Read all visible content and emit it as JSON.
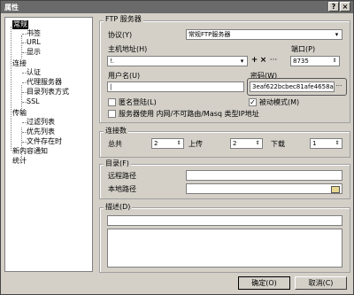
{
  "window": {
    "title": "属性",
    "help": "?",
    "close": "×"
  },
  "tree": {
    "items": [
      {
        "label": "常规"
      },
      {
        "label": "书签"
      },
      {
        "label": "URL"
      },
      {
        "label": "显示"
      },
      {
        "label": "连接"
      },
      {
        "label": "认证"
      },
      {
        "label": "代理服务器"
      },
      {
        "label": "目录列表方式"
      },
      {
        "label": "SSL"
      },
      {
        "label": "传输"
      },
      {
        "label": "过滤列表"
      },
      {
        "label": "优先列表"
      },
      {
        "label": "文件存在时"
      },
      {
        "label": "新内容通知"
      },
      {
        "label": "统计"
      }
    ]
  },
  "ftp": {
    "group_title": "FTP 服务器",
    "protocol_label": "协议(Y)",
    "protocol_value": "常规FTP服务器",
    "host_label": "主机地址(H)",
    "host_value": "!.",
    "port_label": "端口(P)",
    "port_value": "8735",
    "user_label": "用户名(U)",
    "user_value": "|",
    "password_label": "密码(W)",
    "password_value": "3eaf622bcbec81afe4658a06",
    "anon_label": "匿名登陆(L)",
    "passive_label": "被动模式(M)",
    "passive_checked": "✓",
    "private_ip_label": "服务器使用 内网/不可路由/Masq 类型IP地址",
    "btn_plus": "+",
    "btn_x": "×",
    "btn_more": "···",
    "btn_pw_more": "···"
  },
  "conn": {
    "group_title": "连接数",
    "total_label": "总共",
    "total_value": "2",
    "upload_label": "上传",
    "upload_value": "2",
    "download_label": "下载",
    "download_value": "1"
  },
  "dir": {
    "group_title": "目录(F)",
    "remote_label": "远程路径",
    "remote_value": "",
    "local_label": "本地路径",
    "local_value": ""
  },
  "desc": {
    "group_title": "描述(D)"
  },
  "buttons": {
    "ok": "确定(O)",
    "cancel": "取消(C)"
  },
  "icons": {
    "dropdown": "▾",
    "spin": "⇕",
    "folder": "folder-icon",
    "dropdown_down": "chevron-down-icon"
  }
}
